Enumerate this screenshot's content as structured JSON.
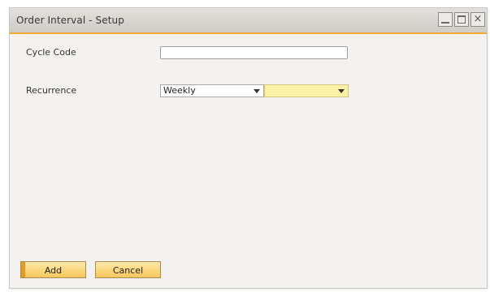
{
  "window": {
    "title": "Order Interval - Setup"
  },
  "form": {
    "cycle_code_label": "Cycle Code",
    "cycle_code_value": "",
    "recurrence_label": "Recurrence",
    "recurrence_value": "Weekly",
    "recurrence_detail_value": ""
  },
  "buttons": {
    "add_label": "Add",
    "cancel_label": "Cancel"
  },
  "icons": {
    "minimize": "minimize-icon",
    "maximize": "maximize-icon",
    "close": "close-icon",
    "close_glyph": "×"
  },
  "colors": {
    "accent": "#f0a92e",
    "highlight_field": "#fdf1a6"
  }
}
